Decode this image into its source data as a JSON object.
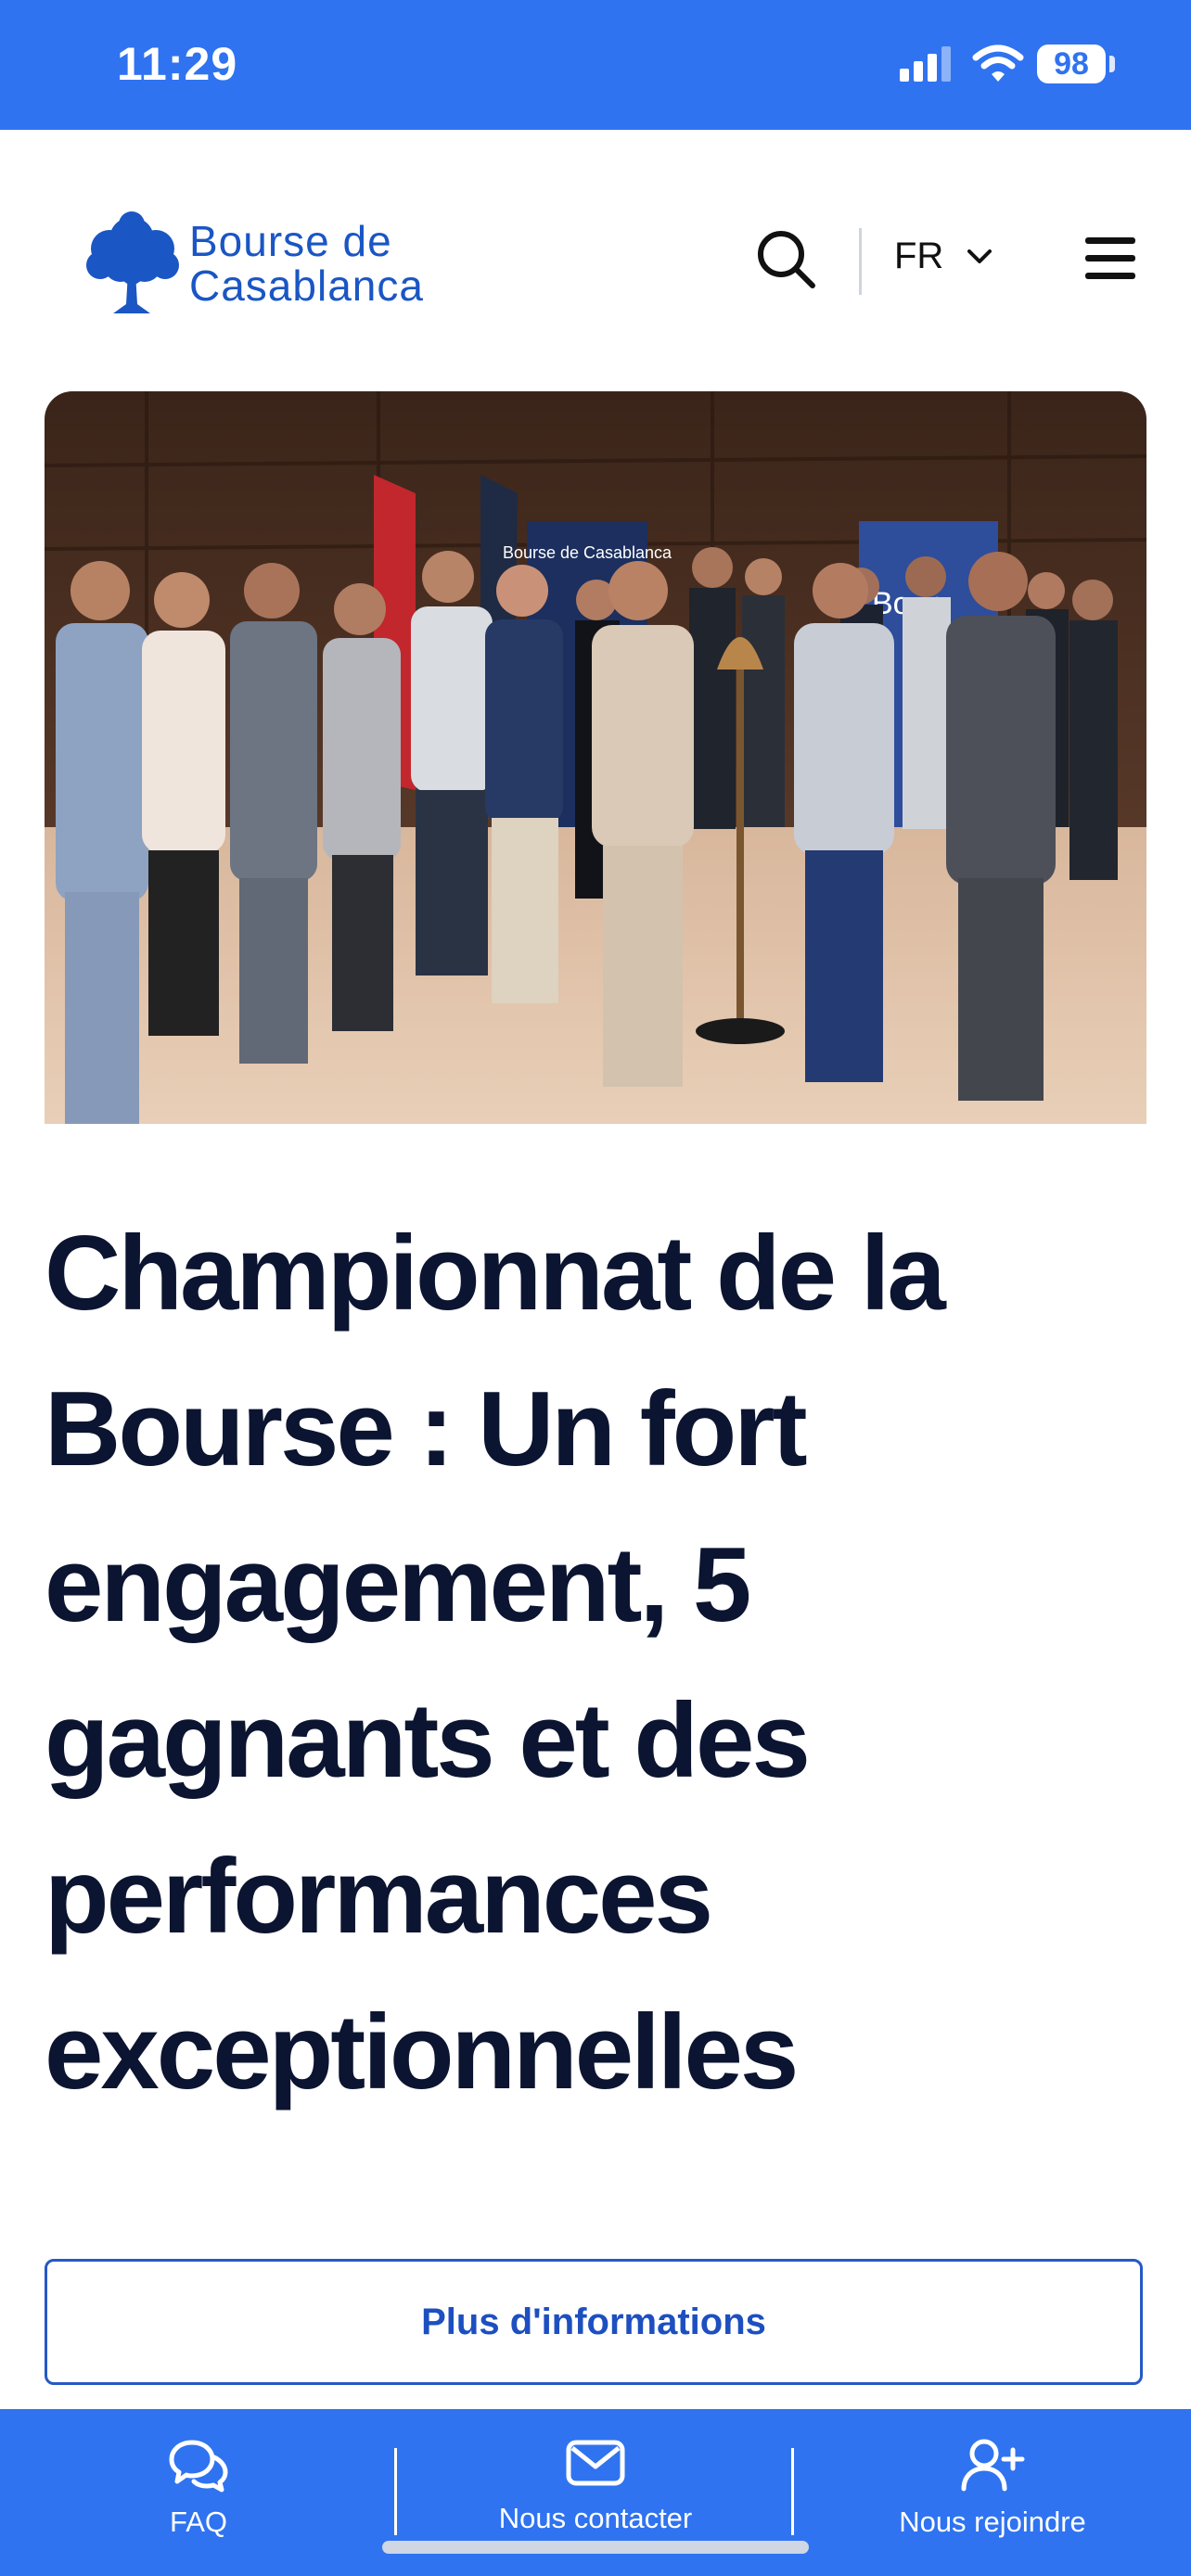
{
  "status_bar": {
    "time": "11:29",
    "battery": "98"
  },
  "header": {
    "logo_line1": "Bourse de",
    "logo_line2": "Casablanca",
    "language": "FR"
  },
  "hero": {
    "podium_logo": "Bourse de Casablanca",
    "banner_text": "Bour"
  },
  "article": {
    "title": "Championnat de la Bourse : Un fort engagement, 5 gagnants et des performances exceptionnelles",
    "cta_label": "Plus d'informations"
  },
  "bottom_nav": {
    "items": [
      {
        "label": "FAQ",
        "icon": "chat-bubbles-icon"
      },
      {
        "label": "Nous contacter",
        "icon": "envelope-icon"
      },
      {
        "label": "Nous rejoindre",
        "icon": "user-plus-icon"
      }
    ]
  },
  "colors": {
    "brand_blue": "#2f73f0",
    "logo_blue": "#1a56c4",
    "title_navy": "#0b1430"
  }
}
